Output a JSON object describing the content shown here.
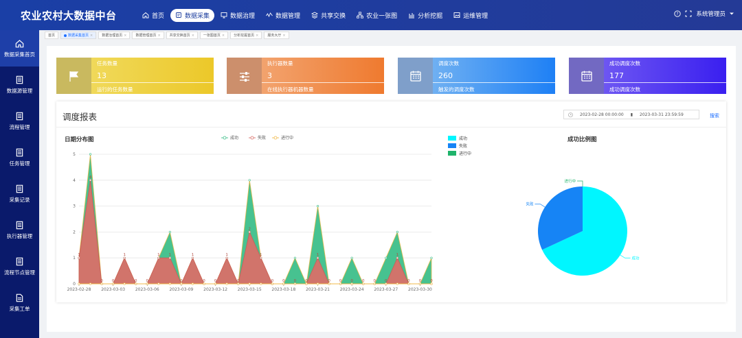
{
  "app_title": "农业农村大数据中台",
  "nav": [
    {
      "label": "首页",
      "icon": "home-icon"
    },
    {
      "label": "数据采集",
      "icon": "database-icon",
      "active": true
    },
    {
      "label": "数据治理",
      "icon": "monitor-icon"
    },
    {
      "label": "数据管理",
      "icon": "wave-icon"
    },
    {
      "label": "共享交换",
      "icon": "layers-icon"
    },
    {
      "label": "农业一张图",
      "icon": "sitemap-icon"
    },
    {
      "label": "分析挖掘",
      "icon": "bar-chart-icon"
    },
    {
      "label": "运维管理",
      "icon": "image-icon"
    }
  ],
  "user": {
    "name": "系统管理员"
  },
  "sidebar": [
    {
      "label": "数据采集首页",
      "icon": "home-icon",
      "active": true
    },
    {
      "label": "数据源管理",
      "icon": "document-icon"
    },
    {
      "label": "流程管理",
      "icon": "document-icon"
    },
    {
      "label": "任务管理",
      "icon": "document-icon"
    },
    {
      "label": "采集记录",
      "icon": "document-icon"
    },
    {
      "label": "执行器管理",
      "icon": "document-icon"
    },
    {
      "label": "流程节点管理",
      "icon": "document-icon"
    },
    {
      "label": "采集工单",
      "icon": "file-icon"
    }
  ],
  "tabs": [
    {
      "label": "首页"
    },
    {
      "label": "数据采集首页",
      "active": true
    },
    {
      "label": "数据治理首页"
    },
    {
      "label": "数据管理首页"
    },
    {
      "label": "共享交换首页"
    },
    {
      "label": "一张图首页"
    },
    {
      "label": "分析挖掘首页"
    },
    {
      "label": "服务大厅"
    }
  ],
  "stats": [
    {
      "title": "任务数量",
      "value": "13",
      "desc": "运行的任务数量",
      "icon": "flag-icon",
      "colors": [
        "#c9b95f",
        "#f0d95a",
        "#ecc829"
      ]
    },
    {
      "title": "执行器数量",
      "value": "3",
      "desc": "在线执行器机器数量",
      "icon": "sliders-icon",
      "colors": [
        "#cc8f6c",
        "#f2a36e",
        "#ef7a2f"
      ]
    },
    {
      "title": "调度次数",
      "value": "260",
      "desc": "触发的调度次数",
      "icon": "calendar-icon",
      "colors": [
        "#7f9fca",
        "#6fb0f2",
        "#1e80f5"
      ]
    },
    {
      "title": "成功调度次数",
      "value": "177",
      "desc": "成功调度次数",
      "icon": "calendar-icon",
      "colors": [
        "#7269c2",
        "#6d56f2",
        "#3a1ff0"
      ]
    }
  ],
  "report": {
    "title": "调度报表",
    "date_start": "2023-02-28 00:00:00",
    "date_end": "2023-03-31 23:59:59",
    "search_label": "搜索"
  },
  "line_chart_title": "日期分布图",
  "pie_chart_title": "成功比例图",
  "chart_data": [
    {
      "type": "area",
      "title": "日期分布图",
      "x": [
        "2023-02-28",
        "2023-03-01",
        "2023-03-02",
        "2023-03-03",
        "2023-03-04",
        "2023-03-05",
        "2023-03-06",
        "2023-03-07",
        "2023-03-08",
        "2023-03-09",
        "2023-03-10",
        "2023-03-11",
        "2023-03-12",
        "2023-03-13",
        "2023-03-14",
        "2023-03-15",
        "2023-03-16",
        "2023-03-17",
        "2023-03-18",
        "2023-03-19",
        "2023-03-20",
        "2023-03-21",
        "2023-03-22",
        "2023-03-23",
        "2023-03-24",
        "2023-03-25",
        "2023-03-26",
        "2023-03-27",
        "2023-03-28",
        "2023-03-29",
        "2023-03-30",
        "2023-03-31"
      ],
      "x_tick_labels": [
        "2023-02-28",
        "2023-03-03",
        "2023-03-06",
        "2023-03-09",
        "2023-03-12",
        "2023-03-15",
        "2023-03-18",
        "2023-03-21",
        "2023-03-24",
        "2023-03-27",
        "2023-03-30"
      ],
      "series": [
        {
          "name": "成功",
          "color": "#3dbf8a",
          "values": [
            1,
            5,
            0,
            0,
            1,
            0,
            0,
            1,
            2,
            0,
            1,
            0,
            0,
            1,
            0,
            4,
            1,
            0,
            0,
            1,
            0,
            3,
            0,
            0,
            1,
            0,
            0,
            1,
            2,
            0,
            0,
            1
          ]
        },
        {
          "name": "失败",
          "color": "#d97069",
          "values": [
            1,
            4,
            0,
            0,
            1,
            0,
            0,
            1,
            1,
            0,
            1,
            0,
            0,
            1,
            0,
            2,
            1,
            0,
            0,
            0,
            0,
            1,
            0,
            0,
            0,
            0,
            0,
            0,
            1,
            0,
            0,
            0
          ]
        },
        {
          "name": "进行中",
          "color": "#f0b848",
          "values": [
            0,
            0,
            0,
            0,
            0,
            0,
            0,
            0,
            0,
            0,
            0,
            0,
            0,
            0,
            0,
            0,
            0,
            0,
            0,
            0,
            0,
            0,
            0,
            0,
            0,
            0,
            0,
            0,
            0,
            0,
            0,
            0
          ]
        }
      ],
      "ylim": [
        0,
        5
      ],
      "yticks": [
        0,
        1,
        2,
        3,
        4,
        5
      ],
      "grid": true,
      "legend": "top-center"
    },
    {
      "type": "pie",
      "title": "成功比例图",
      "labels": [
        "成功",
        "失败",
        "进行中"
      ],
      "values": [
        177,
        83,
        0
      ],
      "colors": [
        "#00f6ff",
        "#1684f5",
        "#1fb36b"
      ],
      "legend": "top-left"
    }
  ]
}
